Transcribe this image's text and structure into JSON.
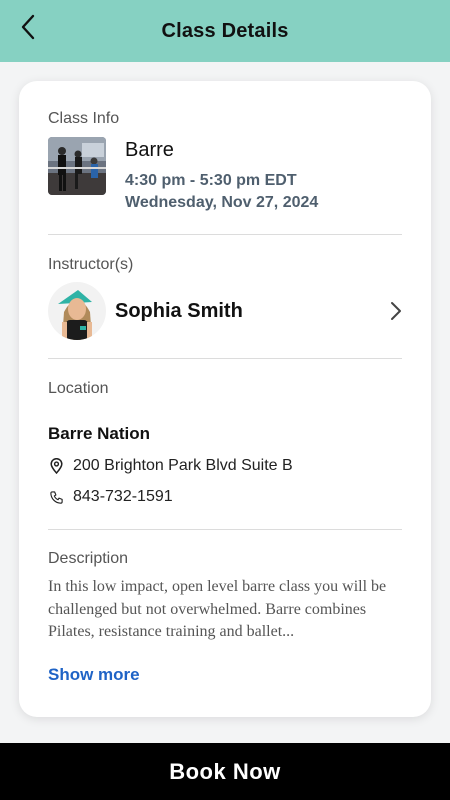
{
  "header": {
    "title": "Class Details"
  },
  "class_info": {
    "label": "Class Info",
    "name": "Barre",
    "time": "4:30 pm - 5:30 pm EDT",
    "date": "Wednesday, Nov 27, 2024"
  },
  "instructor": {
    "label": "Instructor(s)",
    "name": "Sophia Smith"
  },
  "location": {
    "label": "Location",
    "venue": "Barre Nation",
    "address": "200 Brighton Park Blvd Suite B",
    "phone": "843-732-1591"
  },
  "description": {
    "label": "Description",
    "text": "In this low impact, open level barre class you will be challenged but not overwhelmed. Barre combines Pilates, resistance training and ballet...",
    "show_more": "Show more"
  },
  "actions": {
    "book_label": "Book Now"
  },
  "colors": {
    "header_bg": "#86d1c2",
    "link": "#1f63c6",
    "book_bg": "#000000"
  }
}
